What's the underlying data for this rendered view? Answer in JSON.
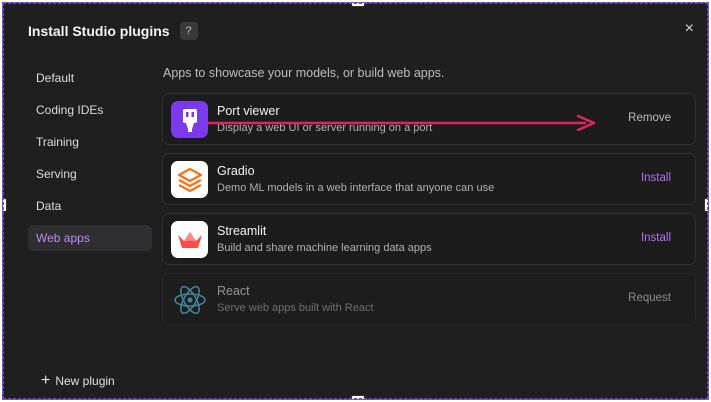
{
  "dialog": {
    "title": "Install Studio plugins",
    "help_label": "?",
    "close_label": "×"
  },
  "sidebar": {
    "items": [
      {
        "label": "Default"
      },
      {
        "label": "Coding IDEs"
      },
      {
        "label": "Training"
      },
      {
        "label": "Serving"
      },
      {
        "label": "Data"
      },
      {
        "label": "Web apps"
      }
    ],
    "active": "Web apps",
    "new_plugin_label": "New plugin"
  },
  "main": {
    "subtitle": "Apps to showcase your models, or build web apps.",
    "plugins": [
      {
        "name": "Port viewer",
        "description": "Display a web UI or server running on a port",
        "action": "Remove",
        "icon": "port-icon"
      },
      {
        "name": "Gradio",
        "description": "Demo ML models in a web interface that anyone can use",
        "action": "Install",
        "icon": "gradio-icon"
      },
      {
        "name": "Streamlit",
        "description": "Build and share machine learning data apps",
        "action": "Install",
        "icon": "streamlit-icon"
      },
      {
        "name": "React",
        "description": "Serve web apps built with React",
        "action": "Request",
        "icon": "react-icon"
      }
    ]
  },
  "colors": {
    "accent": "#b46ff0",
    "background": "#1f1f20",
    "arrow": "#e0245e"
  }
}
